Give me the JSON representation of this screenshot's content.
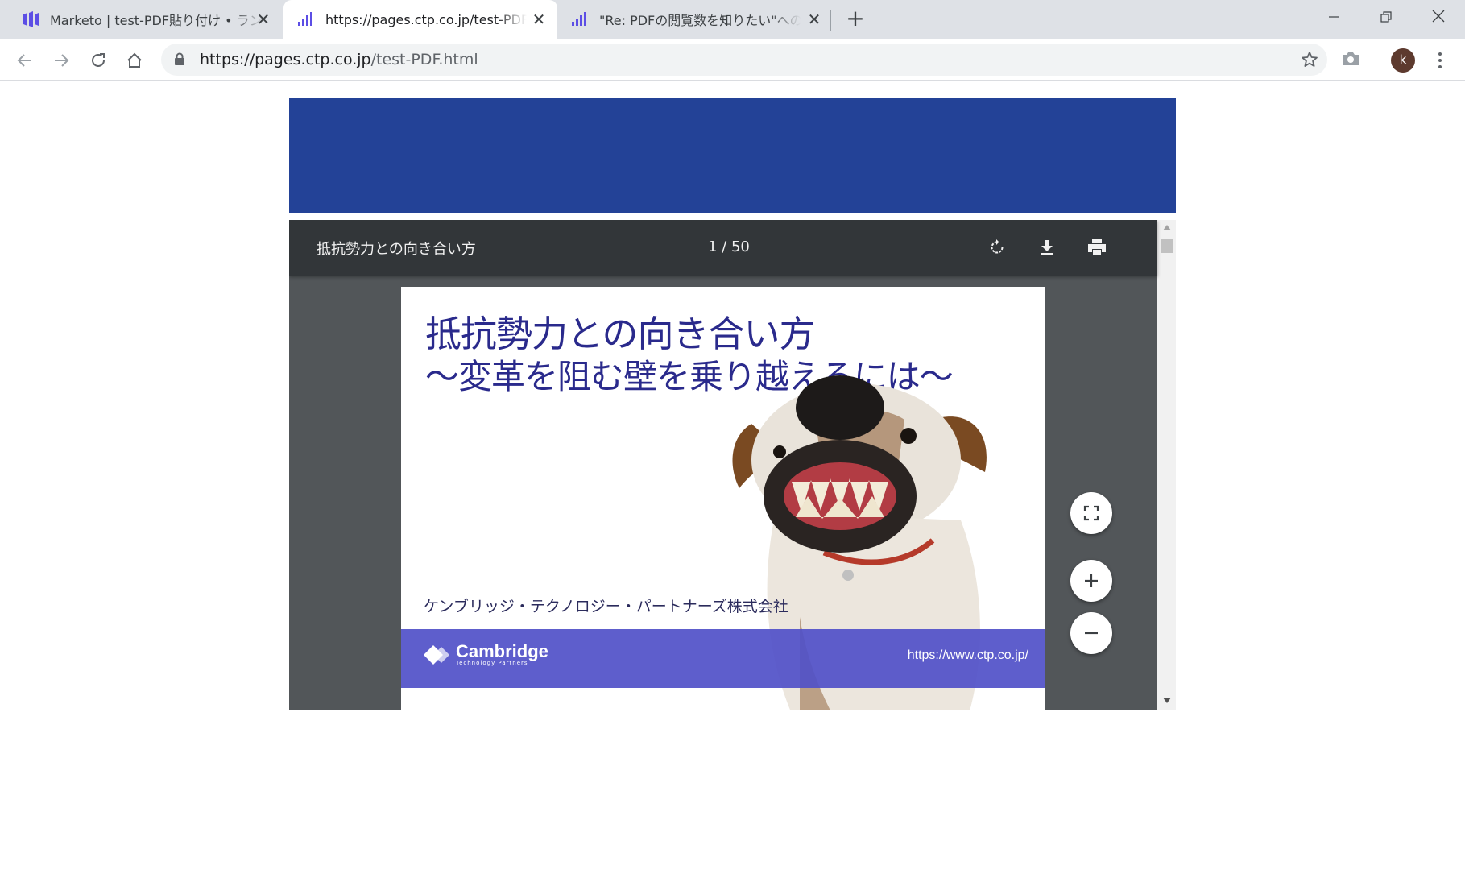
{
  "tabs": [
    {
      "title": "Marketo | test-PDF貼り付け • ランディングページ",
      "close": "✕",
      "favicon": "marketo-icon",
      "active": false
    },
    {
      "title": "https://pages.ctp.co.jp/test-PDF.html",
      "close": "✕",
      "favicon": "marketo-bars-icon",
      "active": true
    },
    {
      "title": "\"Re: PDFの閲覧数を知りたい\"への返信",
      "close": "✕",
      "favicon": "marketo-bars-icon",
      "active": false
    }
  ],
  "new_tab": "+",
  "window": {
    "minimize": "—",
    "restore": "❐",
    "close": "✕"
  },
  "address_bar": {
    "url_host": "https://pages.ctp.co.jp",
    "url_path": "/test-PDF.html"
  },
  "profile": {
    "initial": "k"
  },
  "pdf_viewer": {
    "title": "抵抗勢力との向き合い方",
    "page_indicator": "1 / 50",
    "buttons": [
      "rotate-icon",
      "download-icon",
      "print-icon"
    ]
  },
  "slide": {
    "title": "抵抗勢力との向き合い方",
    "subtitle": "〜変革を阻む壁を乗り越えるには〜",
    "company": "ケンブリッジ・テクノロジー・パートナーズ株式会社",
    "logo_text": "Cambridge",
    "logo_sub": "Technology Partners",
    "footer_url": "https://www.ctp.co.jp/"
  },
  "zoom_controls": [
    "fit-page-icon",
    "zoom-in-icon",
    "zoom-out-icon"
  ],
  "colors": {
    "banner": "#234297",
    "pdf_bg": "#525659",
    "pdf_toolbar": "#323639",
    "accent": "#5050c8",
    "title_text": "#2a2a8c"
  }
}
